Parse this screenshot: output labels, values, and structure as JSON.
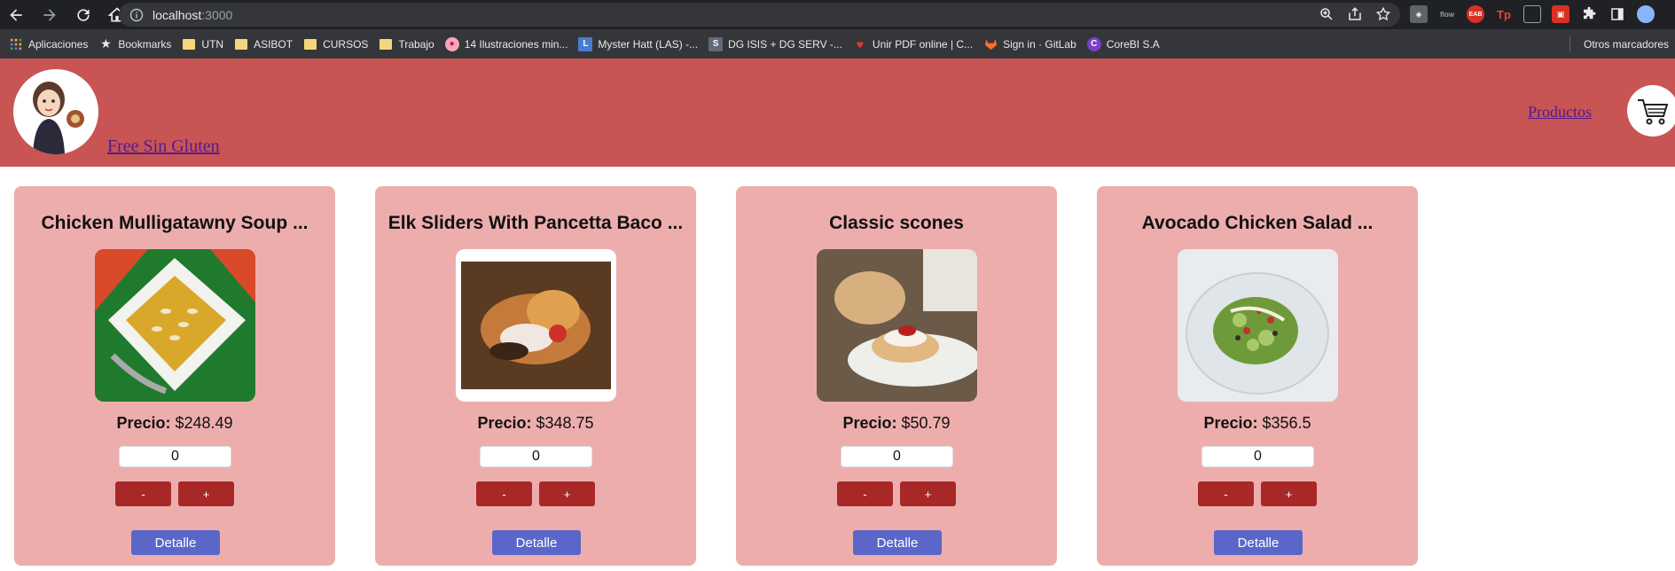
{
  "browser": {
    "url_host": "localhost",
    "url_port": ":3000"
  },
  "bookmarks": [
    {
      "label": "Aplicaciones",
      "icon": "apps-grid-icon"
    },
    {
      "label": "Bookmarks",
      "icon": "star-icon"
    },
    {
      "label": "UTN",
      "icon": "folder-icon"
    },
    {
      "label": "ASIBOT",
      "icon": "folder-icon"
    },
    {
      "label": "CURSOS",
      "icon": "folder-icon"
    },
    {
      "label": "Trabajo",
      "icon": "folder-icon"
    },
    {
      "label": "14 Ilustraciones min...",
      "icon": "site-favicon"
    },
    {
      "label": "Myster Hatt (LAS) -...",
      "icon": "site-favicon"
    },
    {
      "label": "DG ISIS + DG SERV -...",
      "icon": "site-favicon"
    },
    {
      "label": "Unir PDF online | C...",
      "icon": "heart-icon"
    },
    {
      "label": "Sign in · GitLab",
      "icon": "gitlab-icon"
    },
    {
      "label": "CoreBI S.A",
      "icon": "site-favicon"
    }
  ],
  "bookmarks_other": "Otros marcadores",
  "header": {
    "brand": "Free Sin Gluten",
    "nav_productos": "Productos"
  },
  "products": [
    {
      "title": "Chicken Mulligatawny Soup ...",
      "price_label": "Precio:",
      "price": "$248.49",
      "qty": "0",
      "minus": "-",
      "plus": "+",
      "detail": "Detalle"
    },
    {
      "title": "Elk Sliders With Pancetta Baco ...",
      "price_label": "Precio:",
      "price": "$348.75",
      "qty": "0",
      "minus": "-",
      "plus": "+",
      "detail": "Detalle"
    },
    {
      "title": "Classic scones",
      "price_label": "Precio:",
      "price": "$50.79",
      "qty": "0",
      "minus": "-",
      "plus": "+",
      "detail": "Detalle"
    },
    {
      "title": "Avocado Chicken Salad ...",
      "price_label": "Precio:",
      "price": "$356.5",
      "qty": "0",
      "minus": "-",
      "plus": "+",
      "detail": "Detalle"
    }
  ],
  "colors": {
    "header_bg": "#c85454",
    "card_bg": "#eeadad",
    "qty_button": "#a82828",
    "detail_button": "#5a67c9"
  }
}
